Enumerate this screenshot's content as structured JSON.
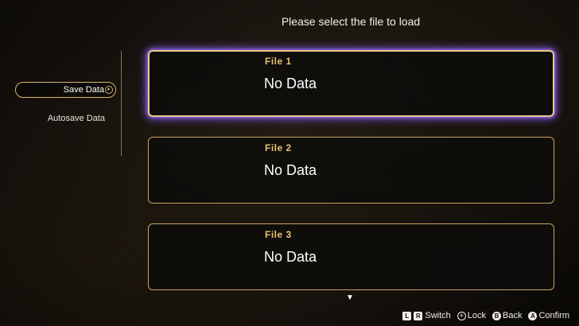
{
  "header": {
    "title": "Please select the file to load"
  },
  "sidebar": {
    "items": [
      {
        "label": "Save Data",
        "selected": true
      },
      {
        "label": "Autosave Data",
        "selected": false
      }
    ],
    "selected_indicator_icon": "right-arrow-icon"
  },
  "slots": [
    {
      "title": "File  1",
      "status": "No Data",
      "active": true
    },
    {
      "title": "File  2",
      "status": "No Data",
      "active": false
    },
    {
      "title": "File  3",
      "status": "No Data",
      "active": false
    }
  ],
  "scroll_indicator": {
    "icon": "down-triangle-icon",
    "glyph": "▼"
  },
  "footer": {
    "switch": {
      "keys": [
        "L",
        "R"
      ],
      "label": "Switch"
    },
    "lock": {
      "key": "+",
      "label": "Lock"
    },
    "back": {
      "key": "B",
      "label": "Back"
    },
    "confirm": {
      "key": "A",
      "label": "Confirm"
    }
  },
  "colors": {
    "accent_gold": "#c9a45e",
    "title_gold": "#e9c170",
    "selection_glow": "#8a5ae6"
  }
}
